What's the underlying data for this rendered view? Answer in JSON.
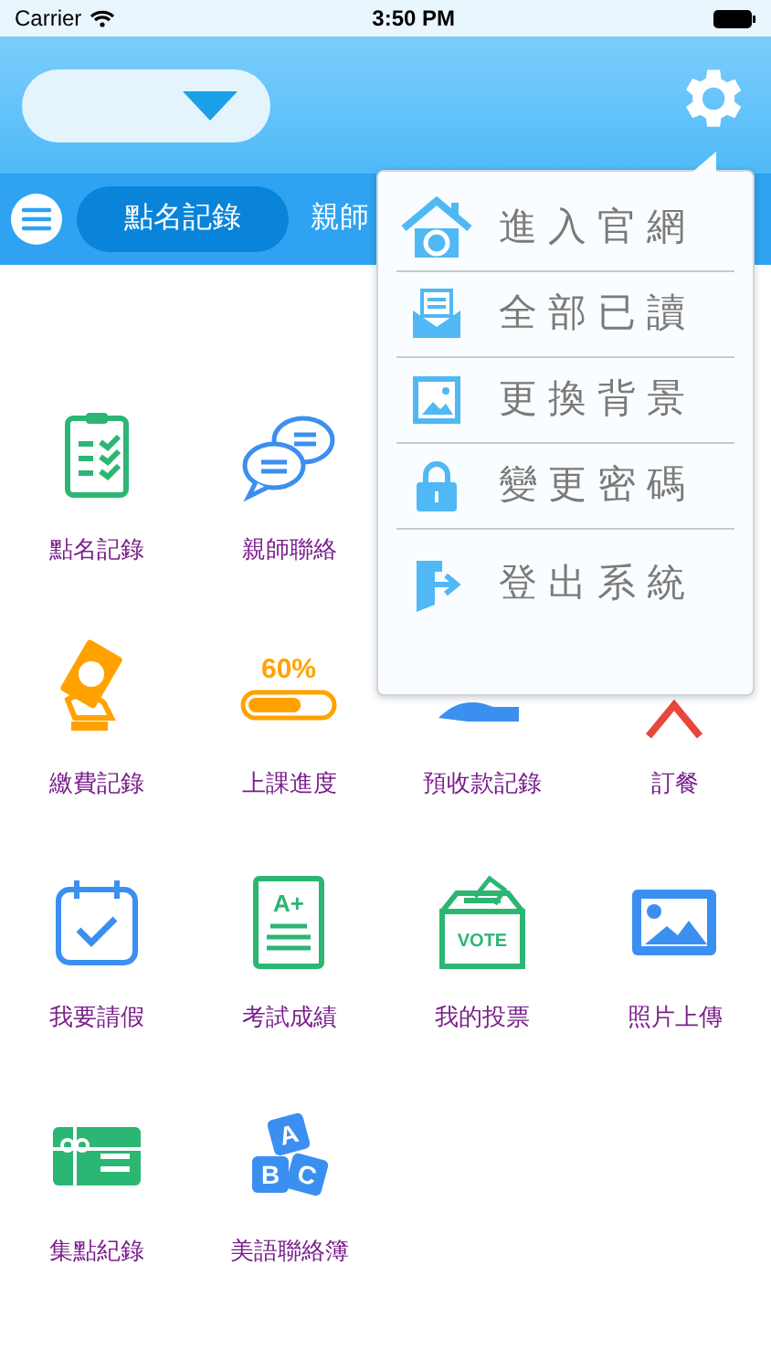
{
  "status_bar": {
    "carrier": "Carrier",
    "time": "3:50 PM"
  },
  "tabs": [
    {
      "label": "點名記錄",
      "selected": true
    },
    {
      "label": "親師",
      "selected": false
    }
  ],
  "menu": {
    "items": [
      {
        "kind": "home",
        "label": "進入官網"
      },
      {
        "kind": "mail",
        "label": "全部已讀"
      },
      {
        "kind": "image",
        "label": "更換背景"
      },
      {
        "kind": "lock",
        "label": "變更密碼"
      },
      {
        "kind": "logout",
        "label": "登出系統"
      }
    ]
  },
  "grid": [
    [
      {
        "kind": "clipboard",
        "label": "點名記錄"
      },
      {
        "kind": "chat",
        "label": "親師聯絡"
      }
    ],
    [
      {
        "kind": "money",
        "label": "繳費記錄"
      },
      {
        "kind": "progress",
        "label": "上課進度",
        "icon_text": "60%",
        "level": 0.65
      },
      {
        "kind": "hand",
        "label": "預收款記錄"
      },
      {
        "kind": "food",
        "label": "訂餐"
      }
    ],
    [
      {
        "kind": "calendar",
        "label": "我要請假"
      },
      {
        "kind": "grade",
        "label": "考試成績",
        "icon_text": "A+"
      },
      {
        "kind": "vote",
        "label": "我的投票",
        "icon_text": "VOTE"
      },
      {
        "kind": "photo",
        "label": "照片上傳"
      }
    ],
    [
      {
        "kind": "gift",
        "label": "集點紀錄"
      },
      {
        "kind": "blocks",
        "label": "美語聯絡簿",
        "icon_letters": [
          "A",
          "B",
          "C"
        ]
      }
    ]
  ]
}
